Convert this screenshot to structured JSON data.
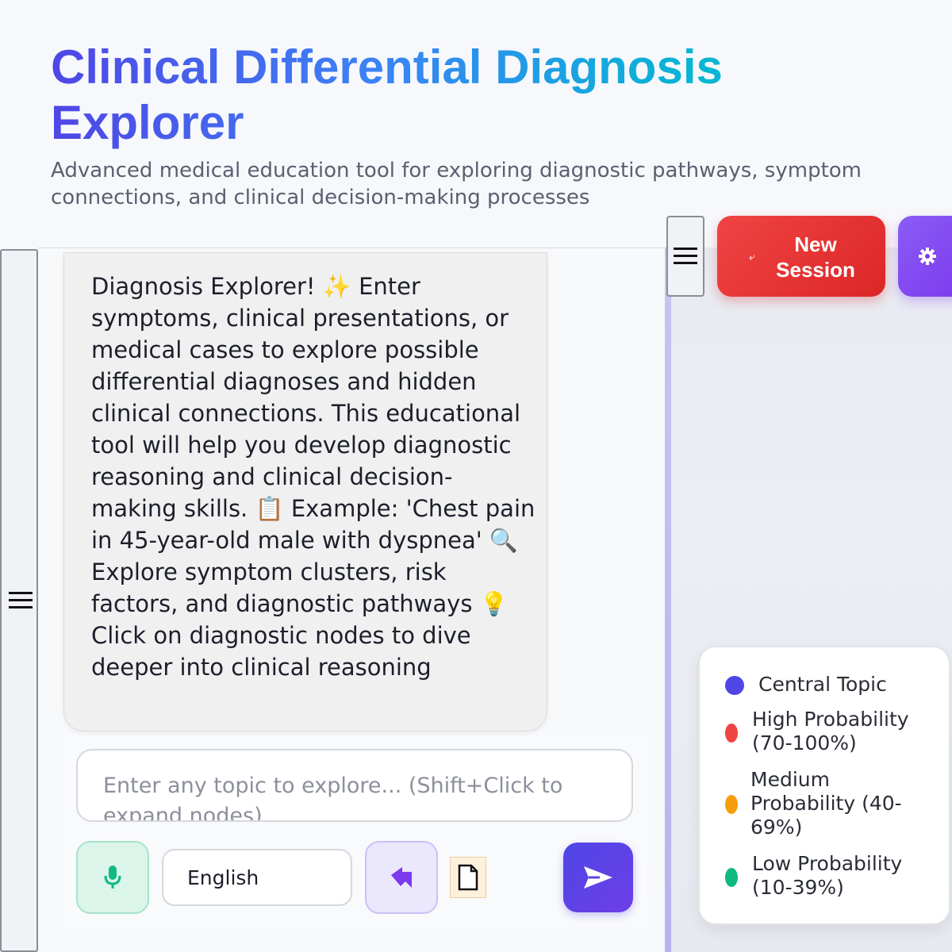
{
  "header": {
    "title": "Clinical Differential Diagnosis Explorer",
    "subtitle": "Advanced medical education tool for exploring diagnostic pathways, symptom connections, and clinical decision-making processes"
  },
  "chat": {
    "message": "Diagnosis Explorer! ✨ Enter symptoms, clinical presentations, or medical cases to explore possible differential diagnoses and hidden clinical connections. This educational tool will help you develop diagnostic reasoning and clinical decision-making skills. 📋 Example: 'Chest pain in 45-year-old male with dyspnea' 🔍 Explore symptom clusters, risk factors, and diagnostic pathways 💡 Click on diagnostic nodes to dive deeper into clinical reasoning"
  },
  "composer": {
    "placeholder": "Enter any topic to explore... (Shift+Click to expand nodes)",
    "language": "English"
  },
  "toolbar": {
    "new_session_label": "New Session"
  },
  "legend": {
    "items": [
      {
        "label": "Central Topic",
        "color": "#4f46e5"
      },
      {
        "label": "High Probability (70-100%)",
        "color": "#ef4444"
      },
      {
        "label": "Medium Probability (40-69%)",
        "color": "#f59e0b"
      },
      {
        "label": "Low Probability (10-39%)",
        "color": "#10b981"
      }
    ]
  },
  "colors": {
    "accent": "#4f46e5",
    "danger": "#dc2626",
    "settings": "#7c3aed",
    "mic": "#10b981"
  },
  "icons": {
    "menu": "hamburger-icon",
    "mic": "microphone-icon",
    "voice": "cursor-icon",
    "file": "document-icon",
    "send": "send-icon",
    "settings": "gear-icon",
    "new_session": "refresh-icon"
  }
}
